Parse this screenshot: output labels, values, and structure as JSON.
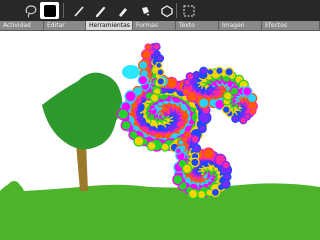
{
  "toolbar": {
    "tools": [
      {
        "name": "lasso-icon"
      },
      {
        "name": "pencil-icon"
      },
      {
        "name": "brush-icon"
      },
      {
        "name": "eraser-icon"
      },
      {
        "name": "bucket-icon"
      },
      {
        "name": "shapes-icon"
      },
      {
        "name": "select-icon"
      }
    ],
    "color_swatch": "#000000"
  },
  "tabs": [
    {
      "label": "Actividad",
      "active": false
    },
    {
      "label": "Editar",
      "active": false
    },
    {
      "label": "Herramientas",
      "active": true
    },
    {
      "label": "Formas",
      "active": false
    },
    {
      "label": "Texto",
      "active": false
    },
    {
      "label": "Imagen",
      "active": false
    },
    {
      "label": "Efectos",
      "active": false
    }
  ],
  "colors": {
    "toolbar_bg": "#282828",
    "tab_bg": "#8a8a8a",
    "tab_active_bg": "#d9d9d9",
    "grass": "#4db32a",
    "tree_foliage": "#2e9a2e",
    "trunk": "#9a7a2a"
  }
}
